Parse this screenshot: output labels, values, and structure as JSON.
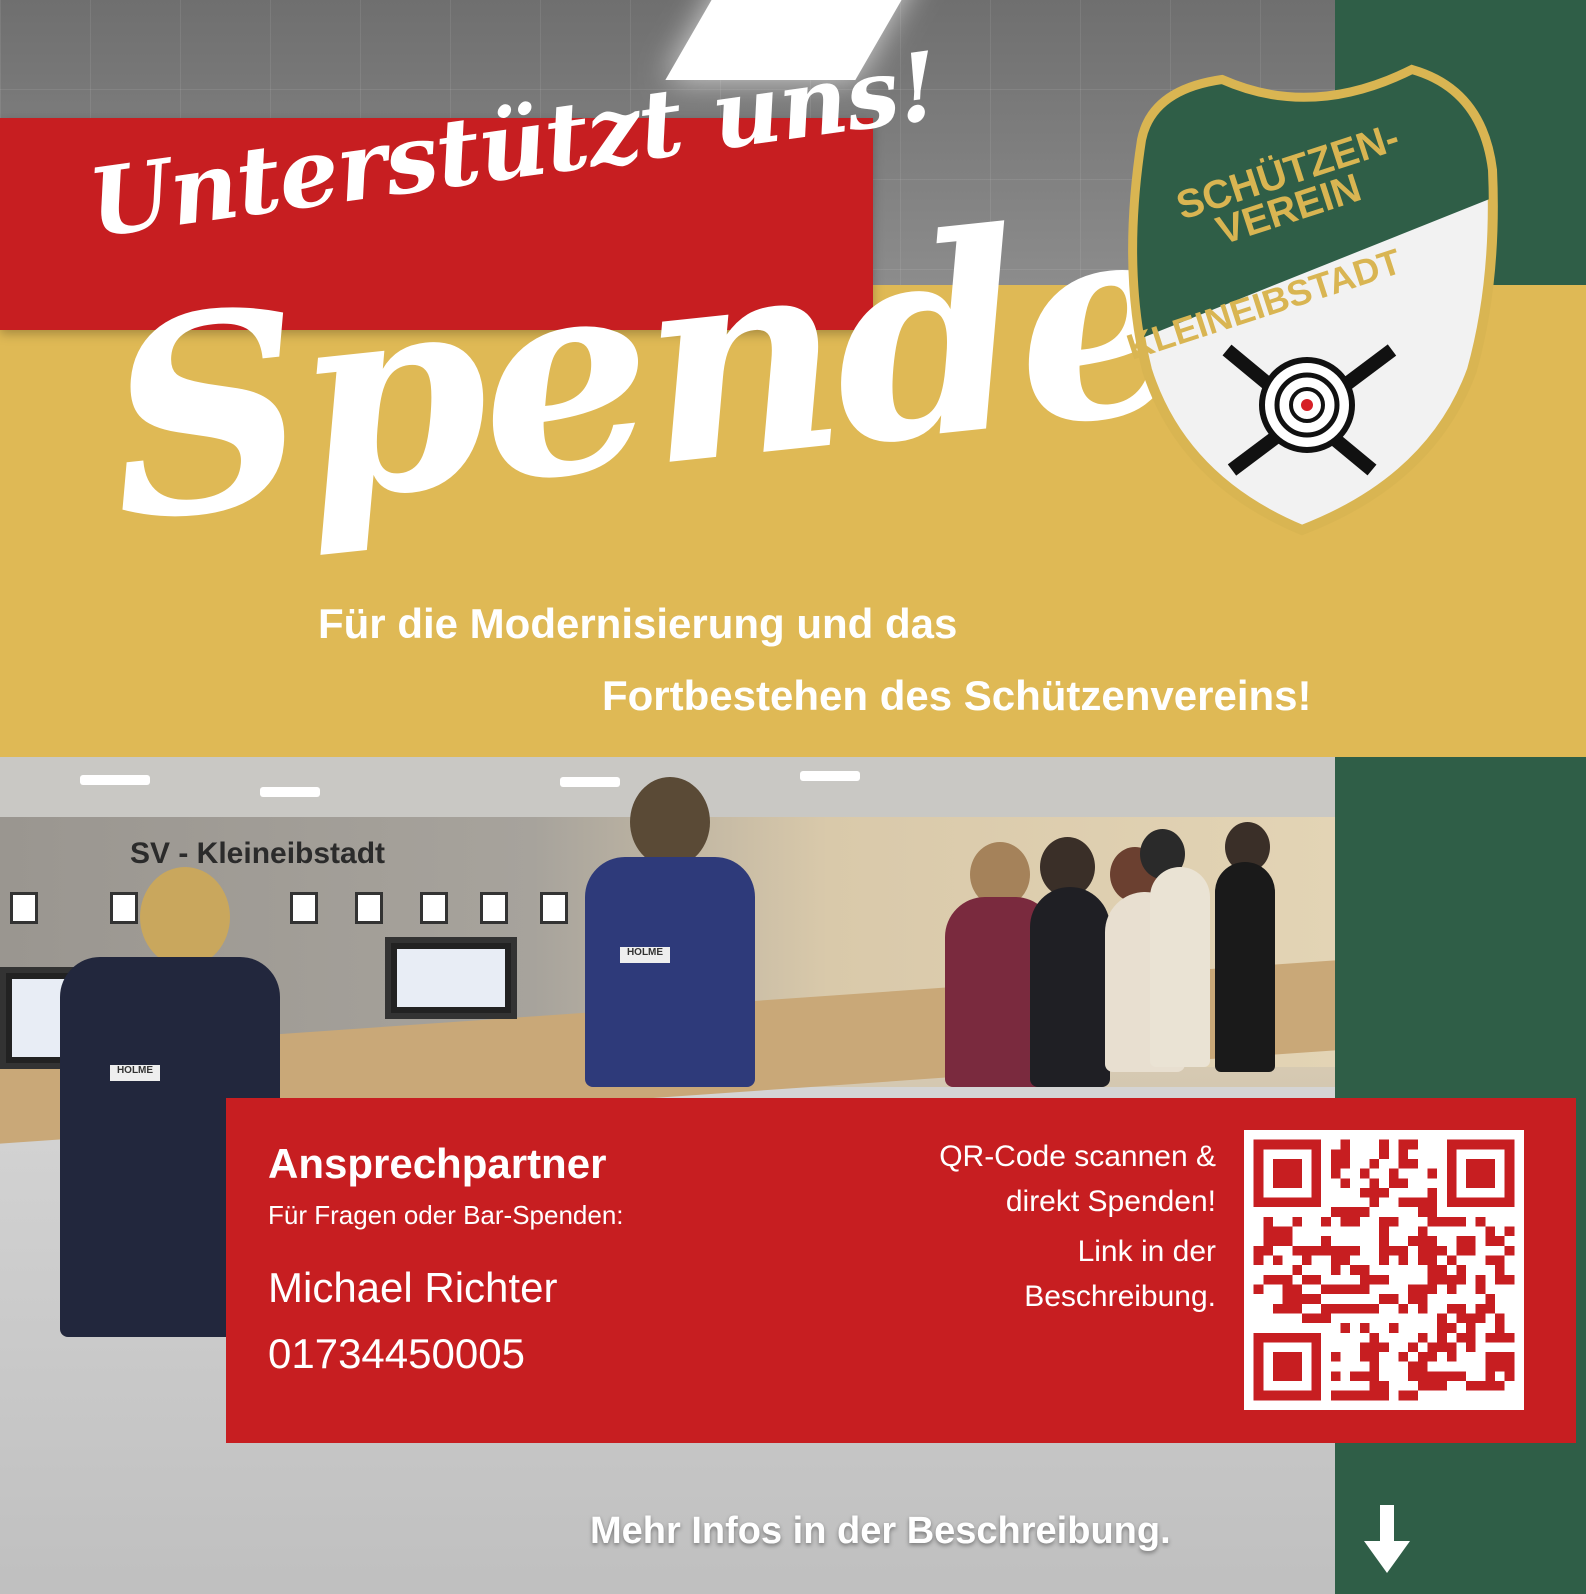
{
  "poster": {
    "headline": "Unterstützt uns!",
    "main_word": "Spenden",
    "subtitle_line1": "Für die Modernisierung und das",
    "subtitle_line2": "Fortbestehen des Schützenvereins!"
  },
  "logo": {
    "line1": "SCHÜTZEN-",
    "line2": "VEREIN",
    "line3": "KLEINEIBSTADT",
    "icon": "crossed-rifles-target-icon"
  },
  "photo": {
    "wall_sign": "SV - Kleineibstadt",
    "vest_brand": "HOLME"
  },
  "contact": {
    "title": "Ansprechpartner",
    "subtitle": "Für Fragen oder Bar-Spenden:",
    "name": "Michael Richter",
    "phone": "01734450005"
  },
  "qr": {
    "line1": "QR-Code scannen &",
    "line2": "direkt Spenden!",
    "line3": "Link in der",
    "line4": "Beschreibung."
  },
  "footer": {
    "text": "Mehr Infos in der Beschreibung.",
    "icon": "arrow-down-icon"
  },
  "colors": {
    "red": "#c71e21",
    "gold": "#dfb955",
    "green": "#2f5e47"
  }
}
